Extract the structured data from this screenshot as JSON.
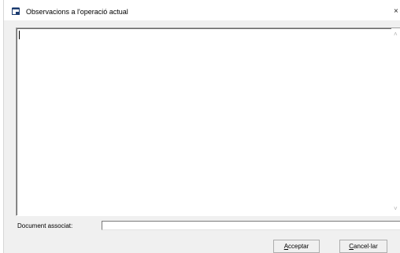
{
  "window": {
    "title": "Observacions a l'operació actual",
    "icon": "document-window-icon",
    "close_glyph": "×"
  },
  "memo": {
    "value": ""
  },
  "document": {
    "label": "Document associat:",
    "value": ""
  },
  "buttons": {
    "accept_accel": "A",
    "accept_rest": "cceptar",
    "cancel_accel": "C",
    "cancel_rest": "ancel·lar"
  },
  "scrollbar": {
    "up_glyph": "˄",
    "down_glyph": "˅"
  }
}
